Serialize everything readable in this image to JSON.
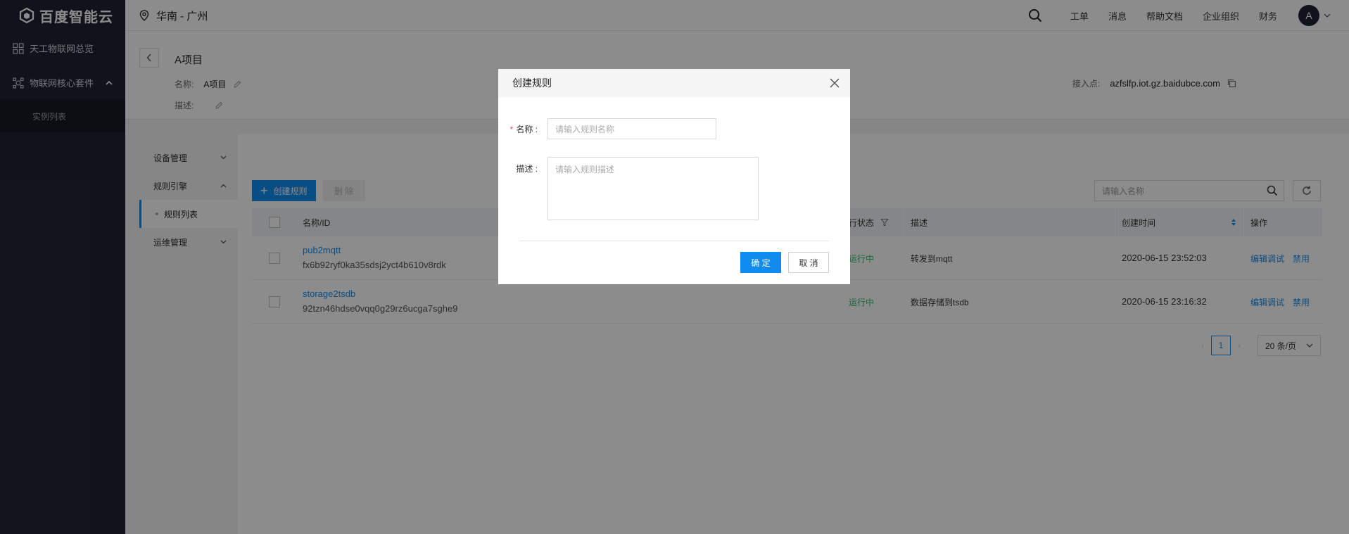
{
  "brand": {
    "logo_text": "百度智能云"
  },
  "topbar": {
    "region": "华南 - 广州",
    "links": [
      "工单",
      "消息",
      "帮助文档",
      "企业组织",
      "财务"
    ],
    "avatar_letter": "A"
  },
  "leftnav": {
    "overview": "天工物联网总览",
    "core_suite": "物联网核心套件",
    "instance_list": "实例列表"
  },
  "project": {
    "title": "A项目",
    "name_label": "名称:",
    "name_value": "A项目",
    "desc_label": "描述:",
    "endpoint_label": "接入点:",
    "endpoint_value": "azfslfp.iot.gz.baidubce.com"
  },
  "subnav": {
    "device_mgmt": "设备管理",
    "rule_engine": "规则引擎",
    "rule_list": "规则列表",
    "ops_mgmt": "运维管理"
  },
  "toolbar": {
    "create_label": "创建规则",
    "delete_label": "删 除",
    "search_placeholder": "请输入名称"
  },
  "table": {
    "headers": {
      "name_id": "名称/ID",
      "status": "行状态",
      "desc": "描述",
      "created": "创建时间",
      "ops": "操作"
    },
    "rows": [
      {
        "name": "pub2mqtt",
        "id": "fx6b92ryf0ka35sdsj2yct4b610v8rdk",
        "status": "运行中",
        "desc": "转发到mqtt",
        "created": "2020-06-15 23:52:03",
        "op1": "编辑调试",
        "op2": "禁用"
      },
      {
        "name": "storage2tsdb",
        "id": "92tzn46hdse0vqq0g29rz6ucga7sghe9",
        "status": "运行中",
        "desc": "数据存储到tsdb",
        "created": "2020-06-15 23:16:32",
        "op1": "编辑调试",
        "op2": "禁用"
      }
    ]
  },
  "pager": {
    "current": "1",
    "page_size": "20 条/页"
  },
  "modal": {
    "title": "创建规则",
    "name_label": "名称 :",
    "name_placeholder": "请输入规则名称",
    "desc_label": "描述 :",
    "desc_placeholder": "请输入规则描述",
    "ok_label": "确 定",
    "cancel_label": "取 消"
  },
  "colors": {
    "accent": "#108cee",
    "dark_nav": "#1f2433",
    "status_ok": "#2dba6a",
    "required": "#e8503a"
  }
}
